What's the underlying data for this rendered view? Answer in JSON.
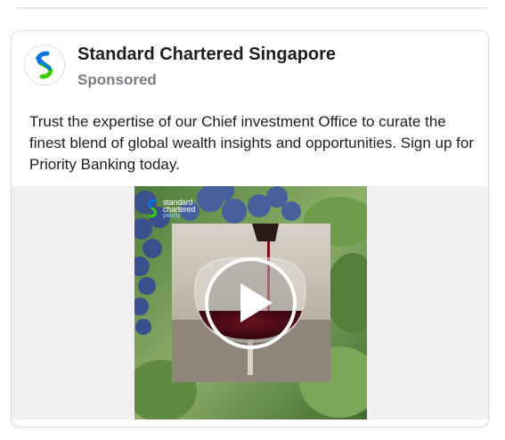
{
  "post": {
    "page_name": "Standard Chartered Singapore",
    "sponsored_label": "Sponsored",
    "message": "Trust the expertise of our Chief investment Office to curate the finest blend of global wealth insights and opportunities. Sign up for Priority Banking today."
  },
  "media": {
    "type": "video",
    "overlay_brand_line1": "standard",
    "overlay_brand_line2": "chartered",
    "overlay_brand_line3": "priority",
    "play_icon": "play-icon"
  },
  "colors": {
    "brand_blue": "#0473ea",
    "brand_green": "#38d200",
    "wine": "#5a0c17"
  }
}
